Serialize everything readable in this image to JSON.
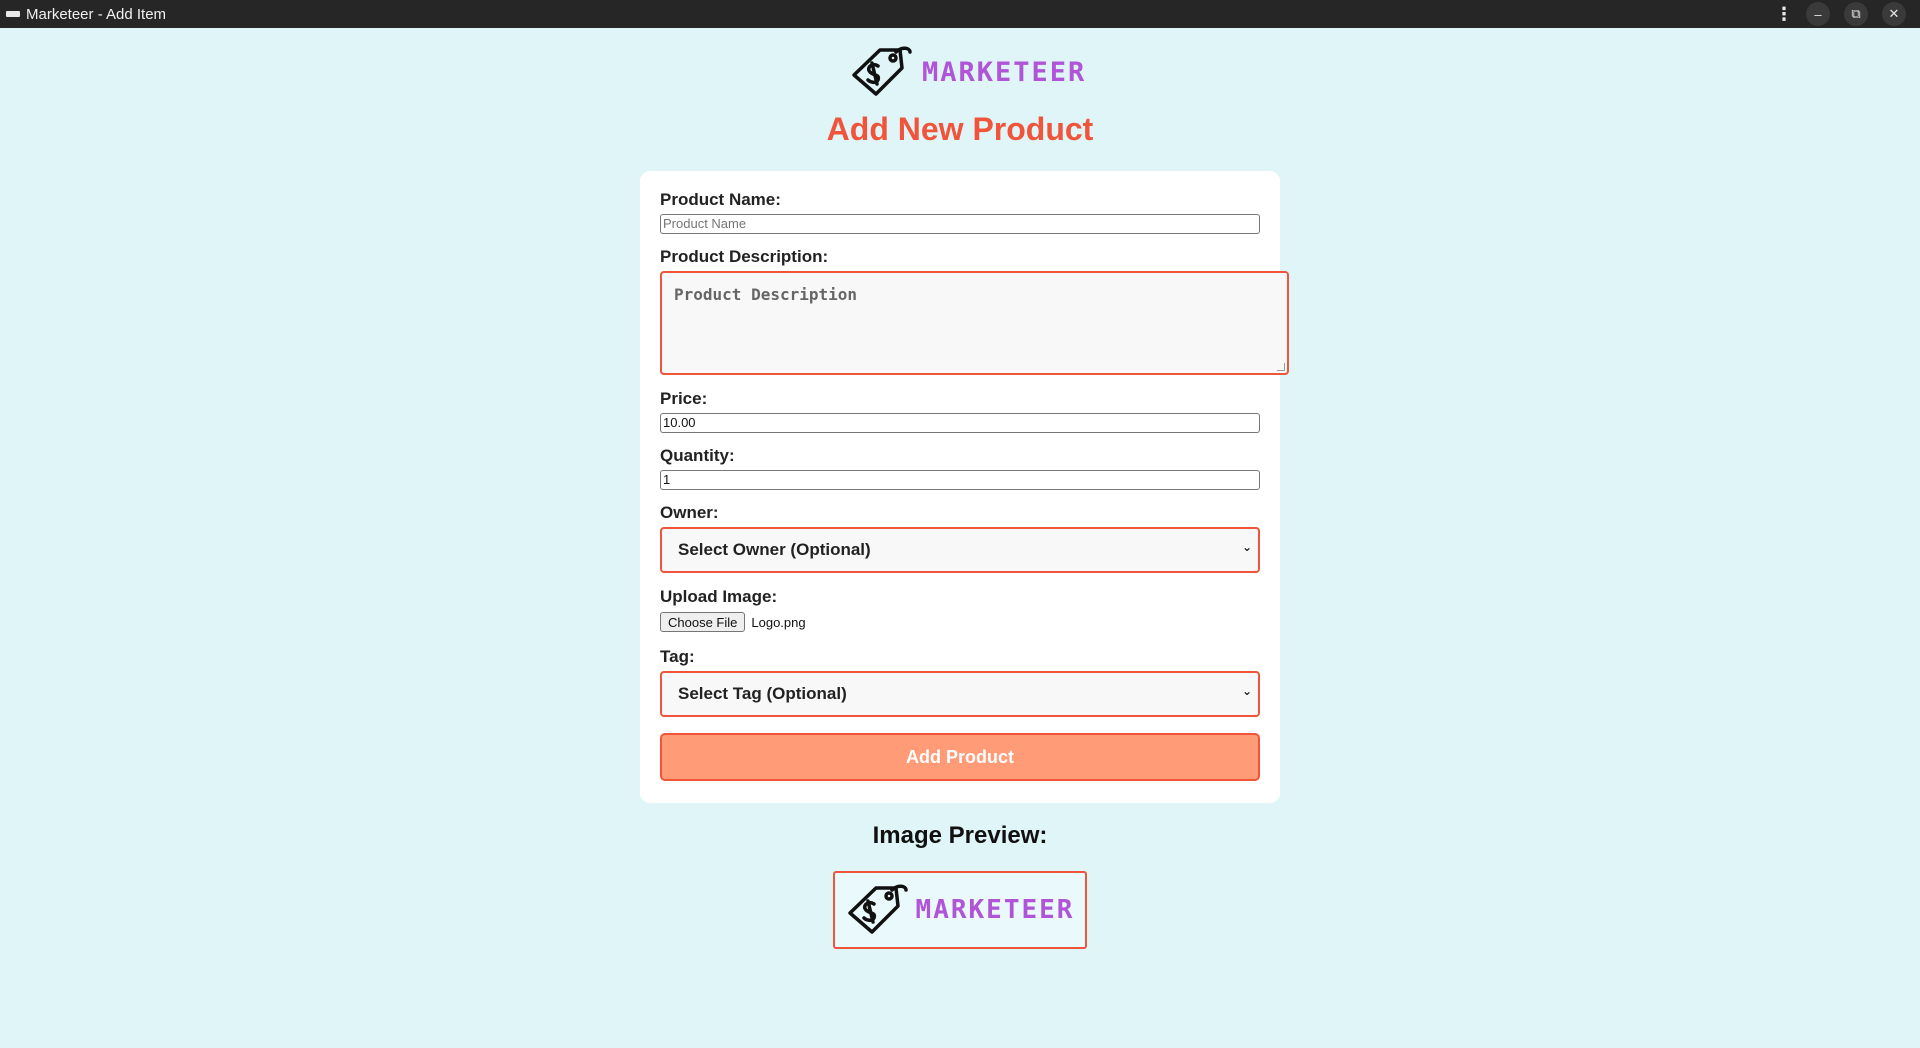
{
  "window": {
    "title": "Marketeer - Add Item"
  },
  "brand": {
    "name": "MARKETEER",
    "logo_icon": "price-tag-dollar-icon",
    "color": "#b054d8"
  },
  "page": {
    "title": "Add New Product",
    "accent_color": "#f0553c"
  },
  "form": {
    "product_name": {
      "label": "Product Name:",
      "value": "",
      "placeholder": "Product Name"
    },
    "description": {
      "label": "Product Description:",
      "value": "",
      "placeholder": "Product Description"
    },
    "price": {
      "label": "Price:",
      "value": "10.00"
    },
    "quantity": {
      "label": "Quantity:",
      "value": "1"
    },
    "owner": {
      "label": "Owner:",
      "selected": "Select Owner (Optional)"
    },
    "image": {
      "label": "Upload Image:",
      "button": "Choose File",
      "file_name": "Logo.png"
    },
    "tag": {
      "label": "Tag:",
      "selected": "Select Tag (Optional)"
    },
    "submit_label": "Add Product"
  },
  "preview": {
    "title": "Image Preview:",
    "image_text": "MARKETEER"
  }
}
